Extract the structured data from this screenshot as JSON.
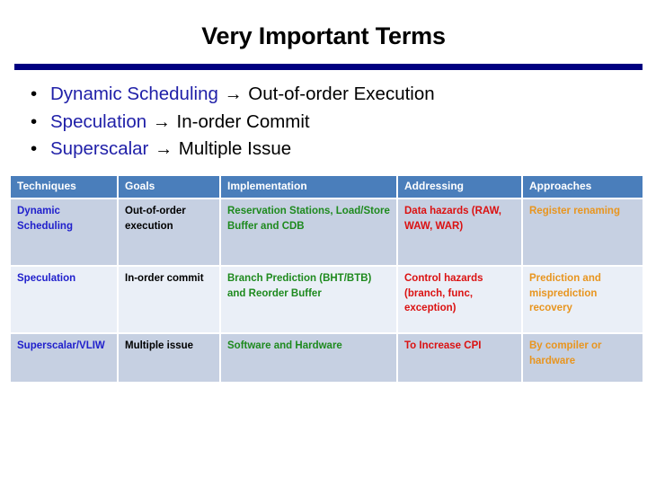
{
  "slide": {
    "title": "Very Important Terms",
    "rule_color": "#000080",
    "bullets": [
      {
        "marker": "•",
        "term": "Dynamic Scheduling",
        "arrow": "→",
        "rest": "Out-of-order Execution"
      },
      {
        "marker": "•",
        "term": "Speculation",
        "arrow": "→",
        "rest": "In-order Commit"
      },
      {
        "marker": "•",
        "term": "Superscalar",
        "arrow": "→",
        "rest": "Multiple Issue"
      }
    ]
  },
  "table": {
    "header_bg": "#4A7EBB",
    "header_color": "#FFFFFF",
    "row_shade_bg": "#C6D0E2",
    "row_plain_bg": "#EAEFF7",
    "column_colors": {
      "techniques": "#2020CC",
      "goals": "#000000",
      "implementation": "#1E8A1E",
      "addressing": "#DB1111",
      "approaches": "#E8951F"
    },
    "headers": [
      "Techniques",
      "Goals",
      "Implementation",
      "Addressing",
      "Approaches"
    ],
    "rows": [
      {
        "techniques": "Dynamic Scheduling",
        "goals": "Out-of-order execution",
        "implementation": "Reservation Stations, Load/Store Buffer and CDB",
        "addressing": "Data hazards (RAW, WAW, WAR)",
        "approaches": "Register renaming"
      },
      {
        "techniques": "Speculation",
        "goals": "In-order commit",
        "implementation": "Branch Prediction (BHT/BTB) and Reorder Buffer",
        "addressing": "Control hazards (branch, func, exception)",
        "approaches": "Prediction and misprediction recovery"
      },
      {
        "techniques": "Superscalar/VLIW",
        "goals": "Multiple issue",
        "implementation": "Software and Hardware",
        "addressing": "To Increase CPI",
        "approaches": "By compiler or hardware"
      }
    ]
  }
}
